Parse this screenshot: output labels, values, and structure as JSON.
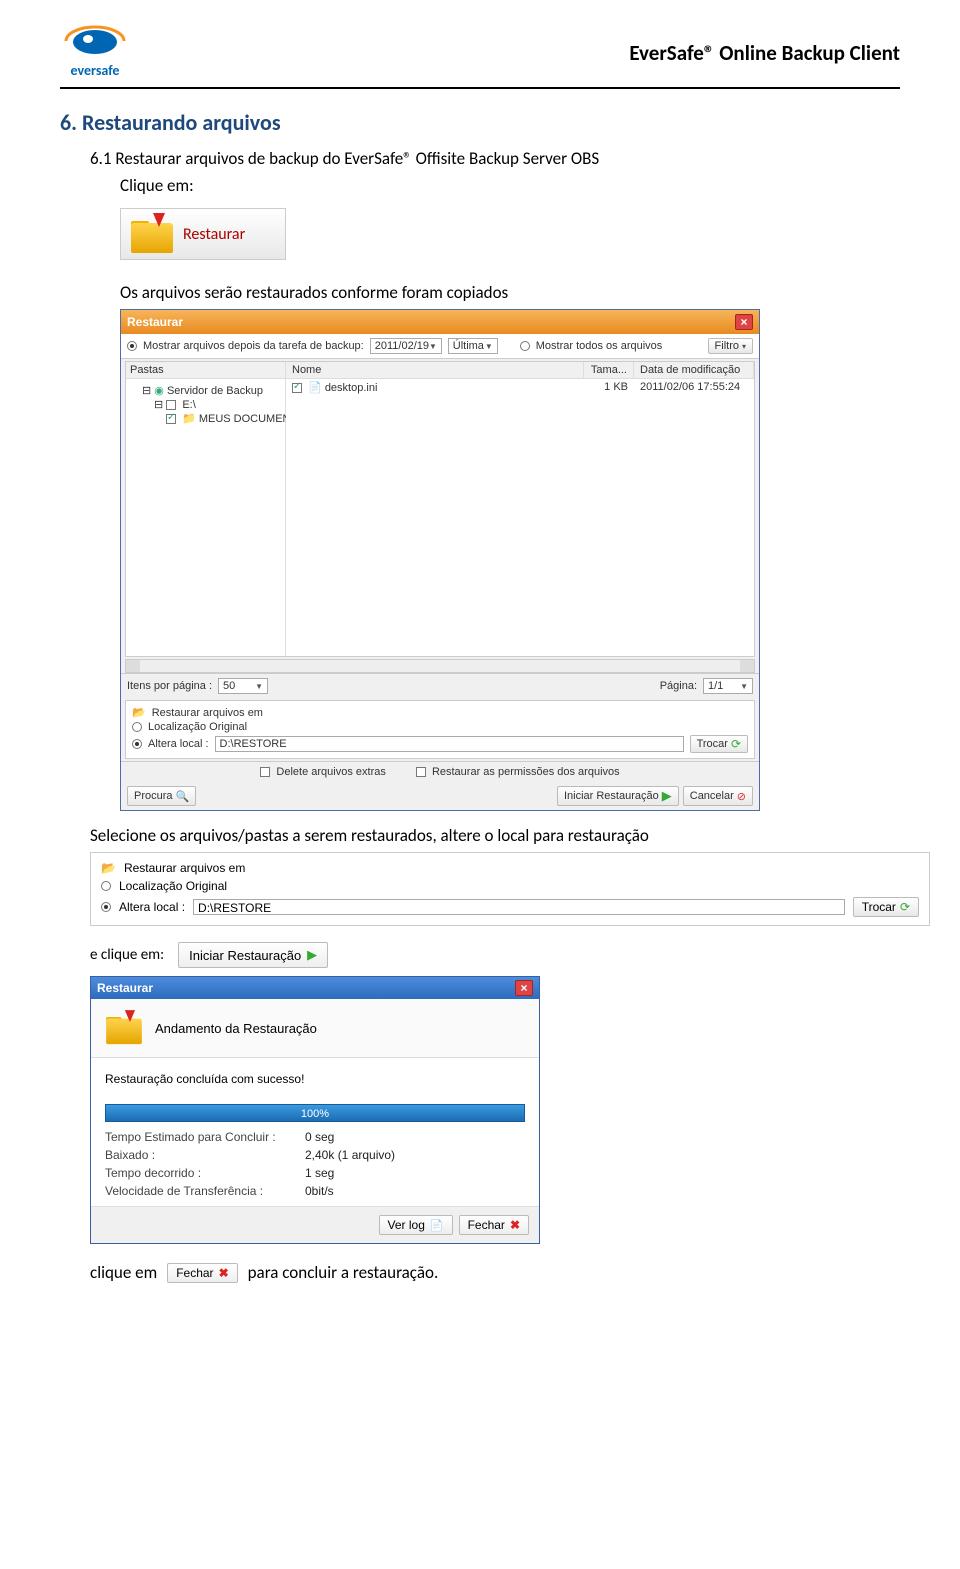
{
  "header": {
    "logo_text": "eversafe",
    "title": "EverSafe® Online Backup Client"
  },
  "doc": {
    "h2": "6.  Restaurando arquivos",
    "p1": "6.1  Restaurar arquivos de backup do EverSafe® Offisite Backup Server OBS",
    "p2": "Clique em:",
    "restaurar_label": "Restaurar",
    "p3": "Os arquivos serão restaurados conforme foram copiados",
    "p4": "Selecione os arquivos/pastas a serem restaurados, altere o local para restauração",
    "p5": "e clique em:",
    "iniciar_label": "Iniciar Restauração",
    "p6a": "clique em",
    "fechar_label": "Fechar",
    "p6b": "para concluir a restauração."
  },
  "dialog1": {
    "title": "Restaurar",
    "radio_after": "Mostrar arquivos depois da tarefa de backup:",
    "date": "2011/02/19",
    "last": "Última",
    "radio_all": "Mostrar todos os arquivos",
    "filtro": "Filtro",
    "tree_hdr": "Pastas",
    "col_name": "Nome",
    "col_tam": "Tama...",
    "col_data": "Data de modificação",
    "tree_root": "Servidor de Backup",
    "tree_e": "E:\\",
    "tree_meus": "MEUS DOCUMENT",
    "file_name": "desktop.ini",
    "file_tam": "1 KB",
    "file_data": "2011/02/06 17:55:24",
    "items_per_page": "Itens por página :",
    "items_val": "50",
    "pagina": "Página:",
    "pagina_val": "1/1",
    "restore_in": "Restaurar arquivos  em",
    "loc_orig": "Localização Original",
    "alt_local": "Altera local :",
    "path": "D:\\RESTORE",
    "trocar": "Trocar",
    "del_extras": "Delete arquivos extras",
    "rest_perm": "Restaurar as permissões dos arquivos",
    "procura": "Procura",
    "iniciar": "Iniciar Restauração",
    "cancelar": "Cancelar"
  },
  "wide": {
    "restore_in": "Restaurar arquivos  em",
    "loc_orig": "Localização Original",
    "alt_local": "Altera local :",
    "path": "D:\\RESTORE",
    "trocar": "Trocar"
  },
  "prog": {
    "title": "Restaurar",
    "hdr": "Andamento da Restauração",
    "success": "Restauração concluída com sucesso!",
    "pct": "100%",
    "time_est_k": "Tempo Estimado para Concluir :",
    "time_est_v": "0 seg",
    "baixado_k": "Baixado :",
    "baixado_v": "2,40k (1 arquivo)",
    "decorrido_k": "Tempo decorrido :",
    "decorrido_v": "1 seg",
    "vel_k": "Velocidade de Transferência :",
    "vel_v": "0bit/s",
    "verlog": "Ver log",
    "fechar": "Fechar"
  }
}
